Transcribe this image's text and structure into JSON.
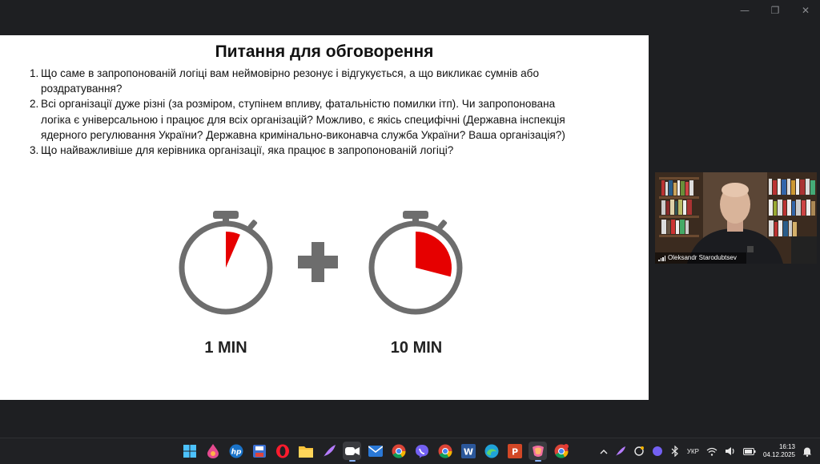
{
  "window_controls": {
    "minimize": "—",
    "restore": "❐",
    "close": "✕"
  },
  "slide": {
    "title": "Питання для обговорення",
    "questions": [
      {
        "num": "1.",
        "lines": [
          "Що саме в запропонованій логіці вам неймовірно резонує і відгукується, а що викликає сумнів або",
          "роздратування?"
        ]
      },
      {
        "num": "2.",
        "lines": [
          "Всі організації дуже різні (за розміром, ступінем впливу, фатальністю помилки ітп). Чи запропонована",
          "логіка є універсальною і працює для всіх організацій? Можливо, є якісь специфічні (Державна інспекція",
          "ядерного регулювання України? Державна кримінально-виконавча служба України? Ваша організація?)"
        ]
      },
      {
        "num": "3.",
        "lines": [
          "Що найважливіше для керівника організації, яка працює в запропонованій логіці?"
        ]
      }
    ],
    "timers": [
      {
        "label": "1 MIN",
        "minutes": 1
      },
      {
        "label": "10 MIN",
        "minutes": 10
      }
    ],
    "colors": {
      "timer_body": "#6d6d6d",
      "timer_fill": "#e60000",
      "plus": "#6d6d6d"
    }
  },
  "video": {
    "participant": "Oleksandr Starodubtsev"
  },
  "taskbar": {
    "icons": [
      {
        "name": "windows-start-icon"
      },
      {
        "name": "paint-drop-icon"
      },
      {
        "name": "hp-icon",
        "text": "hp"
      },
      {
        "name": "save-app-icon"
      },
      {
        "name": "opera-icon"
      },
      {
        "name": "file-explorer-icon"
      },
      {
        "name": "quill-pen-icon"
      },
      {
        "name": "zoom-icon"
      },
      {
        "name": "mail-icon"
      },
      {
        "name": "chrome-icon"
      },
      {
        "name": "viber-icon"
      },
      {
        "name": "chrome-profile-icon"
      },
      {
        "name": "word-icon",
        "text": "W"
      },
      {
        "name": "edge-icon"
      },
      {
        "name": "powerpoint-icon",
        "text": "P"
      },
      {
        "name": "copilot-icon"
      },
      {
        "name": "chrome-notify-icon"
      }
    ],
    "tray": {
      "language": "УКР",
      "time": "16:13",
      "date": "04.12.2025"
    }
  }
}
